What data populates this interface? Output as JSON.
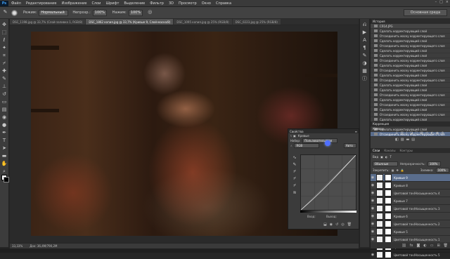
{
  "menu": {
    "logo": "Ps",
    "items": [
      "Файл",
      "Редактирование",
      "Изображение",
      "Слои",
      "Шрифт",
      "Выделение",
      "Фильтр",
      "3D",
      "Просмотр",
      "Окно",
      "Справка"
    ]
  },
  "options": {
    "mode_label": "Режим:",
    "mode_value": "Нормальный",
    "opacity_label": "Непрозр.:",
    "opacity_value": "100%",
    "flow_label": "Нажим:",
    "flow_value": "100%",
    "workspace": "Основная среда"
  },
  "tabs": [
    {
      "label": "DSC_1198.jpg @ 33,7% (Слой-заливка 1, RGB/8)",
      "active": false
    },
    {
      "label": "DSC_1862 копия.jpg @ 33,7% (Кривые 9, Слой-маска/8)",
      "active": true
    },
    {
      "label": "DSC_1095 копия.jpg @ 25% (RGB/8)",
      "active": false
    },
    {
      "label": "DSC_0223.jpg @ 25% (RGB/8)",
      "active": false
    }
  ],
  "status": {
    "zoom": "33,33%",
    "doc": "Док: 36,4M/790,2M"
  },
  "curves_panel": {
    "title": "Свойства",
    "subtitle": "Кривые",
    "preset_label": "Набор:",
    "preset_value": "Пользовательская",
    "channel_value": "RGB",
    "auto_button": "Авто",
    "input_label": "Вход:",
    "output_label": "Выход:"
  },
  "history": {
    "title": "История",
    "snapshot": "CЯ14.JPG",
    "items": [
      {
        "label": "Сделать корректирующий слой",
        "state": "normal"
      },
      {
        "label": "Отсоединить маску корректирующего слоя",
        "state": "normal"
      },
      {
        "label": "Сделать корректирующий слой",
        "state": "normal"
      },
      {
        "label": "Отсоединить маску корректирующего слоя",
        "state": "normal"
      },
      {
        "label": "Сделать корректирующий слой",
        "state": "normal"
      },
      {
        "label": "Сделать корректирующий слой",
        "state": "normal"
      },
      {
        "label": "Отсоединить маску корректирующего слоя",
        "state": "normal"
      },
      {
        "label": "Сделать корректирующий слой",
        "state": "normal"
      },
      {
        "label": "Отсоединить маску корректирующего слоя",
        "state": "normal"
      },
      {
        "label": "Сделать корректирующий слой",
        "state": "normal"
      },
      {
        "label": "Отсоединить маску корректирующего слоя",
        "state": "normal"
      },
      {
        "label": "Сделать корректирующий слой",
        "state": "normal"
      },
      {
        "label": "Сделать корректирующий слой",
        "state": "normal"
      },
      {
        "label": "Отсоединить маску корректирующего слоя",
        "state": "normal"
      },
      {
        "label": "Сделать корректирующий слой",
        "state": "normal"
      },
      {
        "label": "Отсоединить маску корректирующего слоя",
        "state": "normal"
      },
      {
        "label": "Сделать корректирующий слой",
        "state": "normal"
      },
      {
        "label": "Отсоединить маску корректирующего слоя",
        "state": "normal"
      },
      {
        "label": "Сделать корректирующий слой",
        "state": "normal"
      },
      {
        "label": "Отсоединить маску корректирующего слоя",
        "state": "normal"
      },
      {
        "label": "Сделать корректирующий слой",
        "state": "normal"
      },
      {
        "label": "Отсоединить маску корректирующего слоя",
        "state": "selected"
      }
    ]
  },
  "adjustments": {
    "title": "Коррекция",
    "subtitle": "Кривые"
  },
  "layers": {
    "tabs": [
      "Слои",
      "Каналы",
      "Контуры"
    ],
    "kind_label": "Вид",
    "blend_value": "Обычные",
    "opacity_label": "Непрозрачность:",
    "opacity_value": "100%",
    "lock_label": "Закрепить:",
    "fill_label": "Заливка:",
    "fill_value": "100%",
    "items": [
      {
        "label": "Кривые 9",
        "selected": true
      },
      {
        "label": "Кривые 8",
        "selected": false
      },
      {
        "label": "Цветовой тон/Насыщенность 4",
        "selected": false
      },
      {
        "label": "Кривые 7",
        "selected": false
      },
      {
        "label": "Цветовой тон/Насыщенность 3",
        "selected": false
      },
      {
        "label": "Кривые 6",
        "selected": false
      },
      {
        "label": "Цветовой тон/Насыщенность 2",
        "selected": false
      },
      {
        "label": "Кривые 5",
        "selected": false
      },
      {
        "label": "Цветовой тон/Насыщенность 1",
        "selected": false
      },
      {
        "label": "Цветовой баланс 1",
        "selected": false
      },
      {
        "label": "Цветовой тон/Насыщенность 5",
        "selected": false
      }
    ]
  },
  "colors": {
    "accent": "#5a6d8c",
    "ps_blue": "#3d9bf0",
    "cursor_dot": "#4f6fff"
  }
}
